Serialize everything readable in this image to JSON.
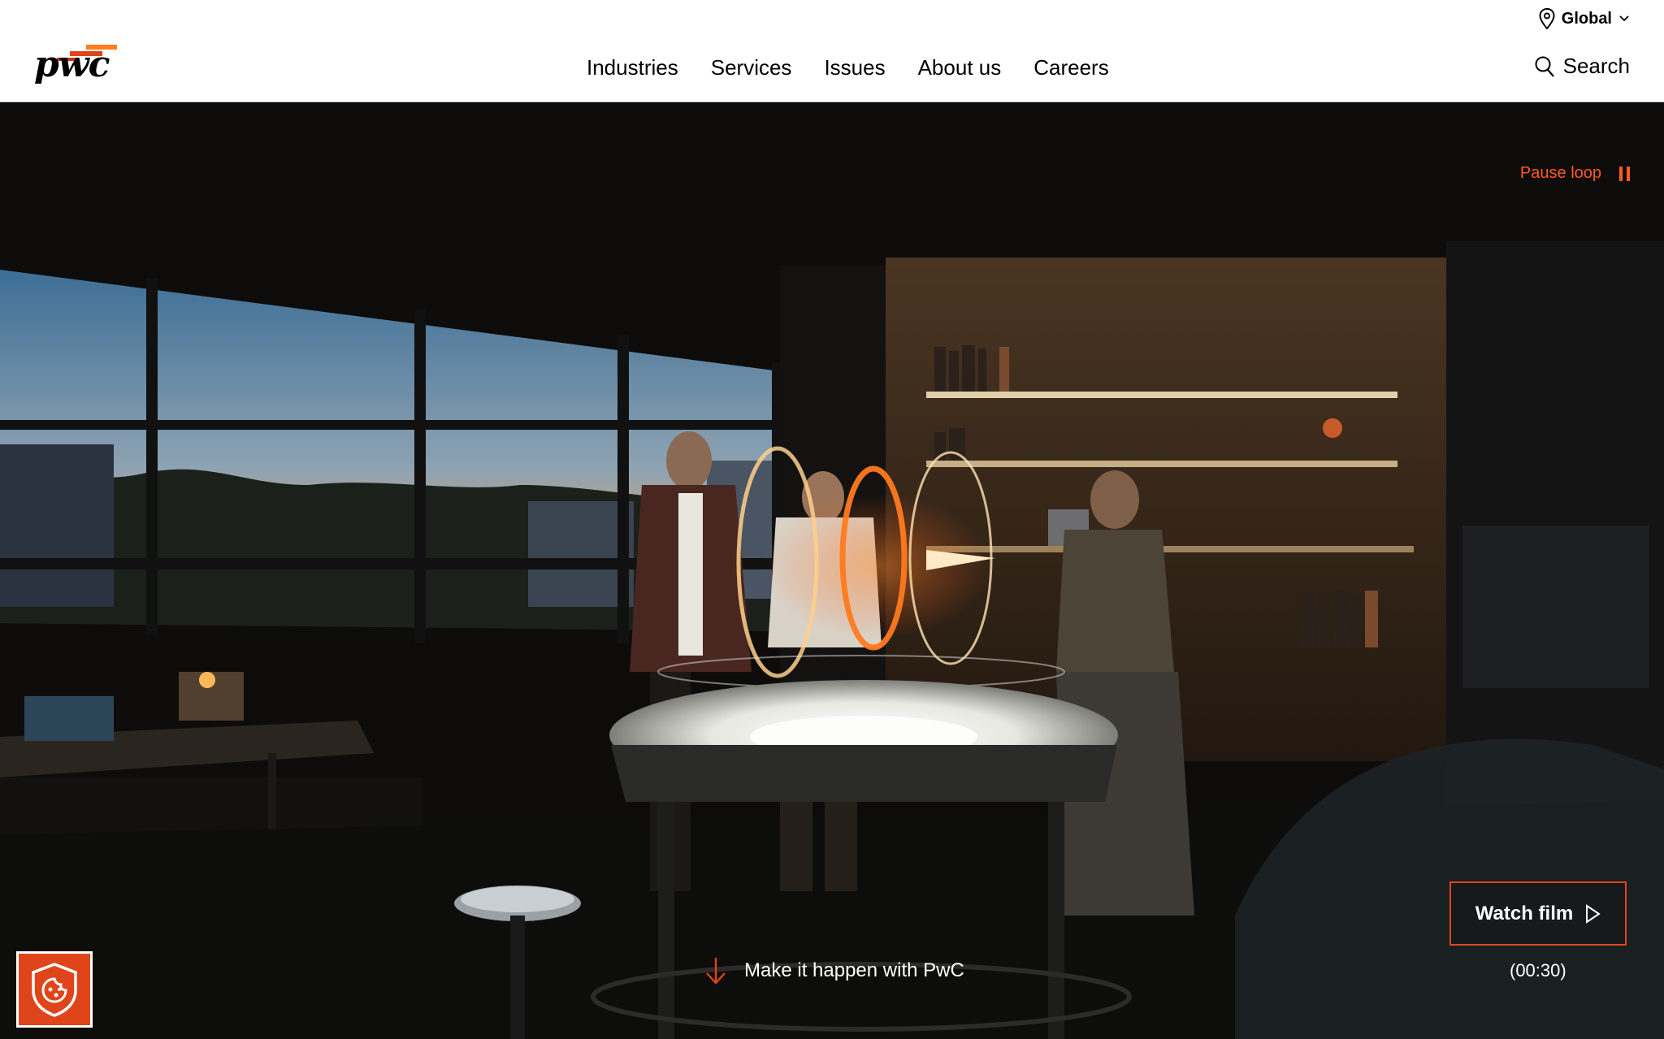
{
  "header": {
    "logo_text": "pwc",
    "region_label": "Global",
    "search_label": "Search",
    "nav": [
      {
        "label": "Industries"
      },
      {
        "label": "Services"
      },
      {
        "label": "Issues"
      },
      {
        "label": "About us"
      },
      {
        "label": "Careers"
      }
    ]
  },
  "hero": {
    "pause_label": "Pause loop",
    "watch_film_label": "Watch film",
    "duration": "(00:30)",
    "scroll_cta": "Make it happen with PwC"
  },
  "colors": {
    "accent": "#e0441b",
    "accent_text": "#ff5a1f",
    "header_bg": "#ffffff"
  },
  "icons": {
    "region": "location-pin-icon",
    "region_toggle": "chevron-down-icon",
    "search": "search-icon",
    "pause": "pause-icon",
    "play": "play-icon",
    "scroll": "arrow-down-icon",
    "cookie": "cookie-shield-icon"
  }
}
